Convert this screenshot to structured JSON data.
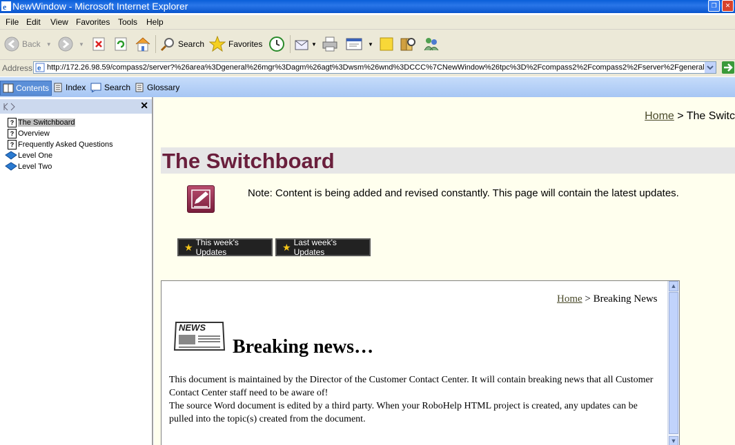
{
  "window": {
    "title": "NewWindow - Microsoft Internet Explorer"
  },
  "menu": [
    "File",
    "Edit",
    "View",
    "Favorites",
    "Tools",
    "Help"
  ],
  "toolbar": {
    "back": "Back",
    "search": "Search",
    "favorites": "Favorites"
  },
  "address": {
    "label": "Address",
    "url": "http://172.26.98.59/compass2/server?%26area%3Dgeneral%26mgr%3Dagm%26agt%3Dwsm%26wnd%3DCCC%7CNewWindow%26tpc%3D%2Fcompass2%2Fcompass2%2Fserver%2Fgeneral%"
  },
  "helpbar": {
    "contents": "Contents",
    "index": "Index",
    "search": "Search",
    "glossary": "Glossary"
  },
  "toc": [
    {
      "label": "The Switchboard",
      "type": "page"
    },
    {
      "label": "Overview",
      "type": "page"
    },
    {
      "label": "Frequently Asked Questions",
      "type": "page"
    },
    {
      "label": "Level One",
      "type": "book"
    },
    {
      "label": "Level Two",
      "type": "book"
    }
  ],
  "main": {
    "breadcrumb_home": "Home",
    "breadcrumb_rest": " > The Switc",
    "title": "The Switchboard",
    "note": "Note: Content is being added and revised constantly. This page will contain the latest updates.",
    "btn_this_week": "This week's Updates",
    "btn_last_week": "Last week's Updates"
  },
  "inner": {
    "breadcrumb_home": "Home",
    "breadcrumb_rest": " > Breaking News",
    "news_logo": "NEWS",
    "title": "Breaking news…",
    "para1": "This document is maintained by the Director of the Customer Contact Center. It will contain breaking news that all Customer Contact Center staff need to be aware of!",
    "para2": "The source Word document is edited by a third party. When your RoboHelp HTML project is created, any updates can be pulled into the topic(s) created from the document."
  }
}
